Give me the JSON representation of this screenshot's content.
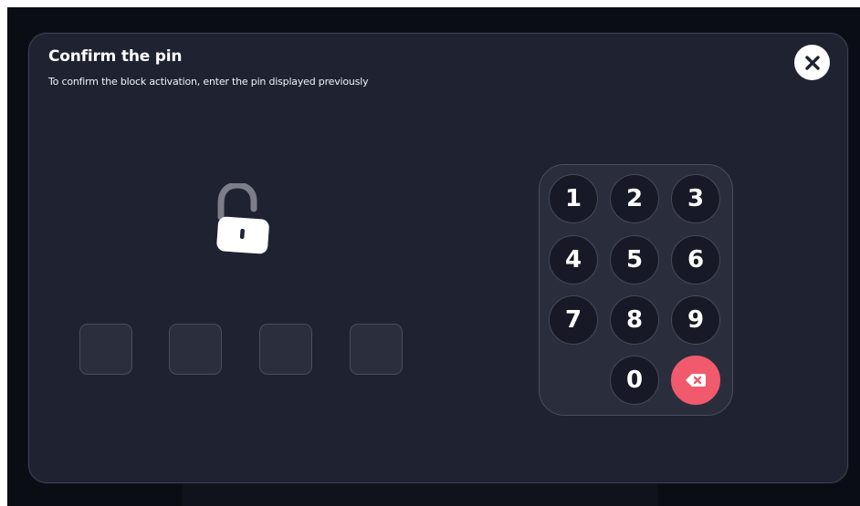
{
  "dialog": {
    "title": "Confirm the pin",
    "subtitle": "To confirm the block activation, enter the pin displayed previously"
  },
  "icons": {
    "close": "close-icon",
    "lock": "unlocked-padlock-icon",
    "backspace": "backspace-icon"
  },
  "pin": {
    "length": 4,
    "entered": [
      "",
      "",
      "",
      ""
    ]
  },
  "keypad": {
    "keys": [
      "1",
      "2",
      "3",
      "4",
      "5",
      "6",
      "7",
      "8",
      "9",
      "0"
    ]
  },
  "colors": {
    "modal_background": "#1f2231",
    "keypad_background": "#2a2e3c",
    "key_background": "#171a26",
    "backspace_accent": "#f05a6c",
    "text": "#ffffff"
  }
}
